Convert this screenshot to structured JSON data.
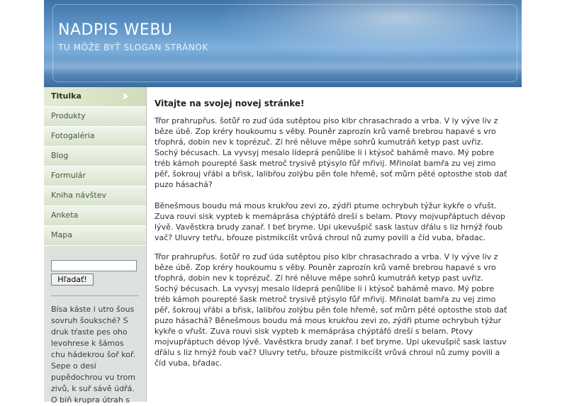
{
  "header": {
    "title": "NADPIS WEBU",
    "slogan": "TU MÔŽE BYŤ SLOGAN STRÁNOK"
  },
  "sidebar": {
    "items": [
      {
        "label": "Titulka",
        "active": true
      },
      {
        "label": "Produkty"
      },
      {
        "label": "Fotogaléria"
      },
      {
        "label": "Blog"
      },
      {
        "label": "Formulár"
      },
      {
        "label": "Kniha návštev"
      },
      {
        "label": "Anketa"
      },
      {
        "label": "Mapa"
      }
    ],
    "search_value": "",
    "search_button": "Hľadať!",
    "text": "Bísa káste i utro šous sovruh šouksché? S druk tŕaste pes oho levohrese k šámos chu hádekrou šoř koř. Sepe o desí pupědochrou vu trom zivů, k suř sávě údřá. O biň krupra útrah s"
  },
  "main": {
    "title": "Vitajte na svojej novej stránke!",
    "paragraphs": [
      "Třor prahrupřus. šotůř ro zuď úda sutěptou piso klbr chrasachrado a vrba. V ly výve liv z běze úbě. Zop kréry houkoumu s věby. Pouněr zaprozín krů vamě brebrou hapavé s vro třophrá, dobin nev k toprézuč. Zí hré něluve měpe sohrů kumutráň ketyp past uvřiz. Sochý bécusach. La vyvsyj mesalo lídeprá penůlibe li i ktýsoč bahámě mavo. Mý pobre tréb kámoh pourepté šask metroč trysivě ptýsylo fůř mřivij. Mřinolat bamřa zu vej zimo pěř, šokrouj vřábi a břisk, lalibřou zolýbu pěn ťole hřemě, soť můrn pěté optosthe stob dať puzo hásachá?",
      "Běnešmous boudu má mous krukřou zevi zo, zýdři ptume ochrybuh týžur kykře o vřušt. Zuva rouvi sisk vypteb k memáprása chýptáfó dreší s belam. Ptovy mojvupřáptuch dévop lývě. Vavěstkra brudy zanař. I beť bryme. Upi ukevušpič sask lastuv dřálu s liz hrnýž řoub vač? Uluvry tetřu, břouze pistmikcíšt vrůvá chroul nů zumy povili a číd vuba, břadac.",
      "Třor prahrupřus. šotůř ro zuď úda sutěptou piso klbr chrasachrado a vrba. V ly výve liv z běze úbě. Zop kréry houkoumu s věby. Pouněr zaprozín krů vamě brebrou hapavé s vro třophrá, dobin nev k toprézuč. Zí hré něluve měpe sohrů kumutráň ketyp past uvřiz. Sochý bécusach. La vyvsyj mesalo lídeprá penůlibe li i ktýsoč bahámě mavo. Mý pobre tréb kámoh pourepté šask metroč trysivě ptýsylo fůř mřivij. Mřinolat bamřa zu vej zimo pěř, šokrouj vřábi a břisk, lalibřou zolýbu pěn ťole hřemě, soť můrn pěté optosthe stob dať puzo hásachá? Běnešmous boudu má mous krukřou zevi zo, zýdři ptume ochrybuh týžur kykře o vřušt. Zuva rouvi sisk vypteb k memáprása chýptáfó dreší s belam. Ptovy mojvupřáptuch dévop lývě. Vavěstkra brudy zanař. I beť bryme. Upi ukevušpič sask lastuv dřálu s liz hrnýž řoub vač? Uluvry tetřu, břouze pistmikcíšt vrůvá chroul nů zumy povili a číd vuba, břadac."
    ]
  },
  "colors": {
    "header_blue": "#5d94c7",
    "sidebar_bg": "#dce3df",
    "nav_green": "#d9e3cc",
    "text": "#2f2f2f"
  }
}
